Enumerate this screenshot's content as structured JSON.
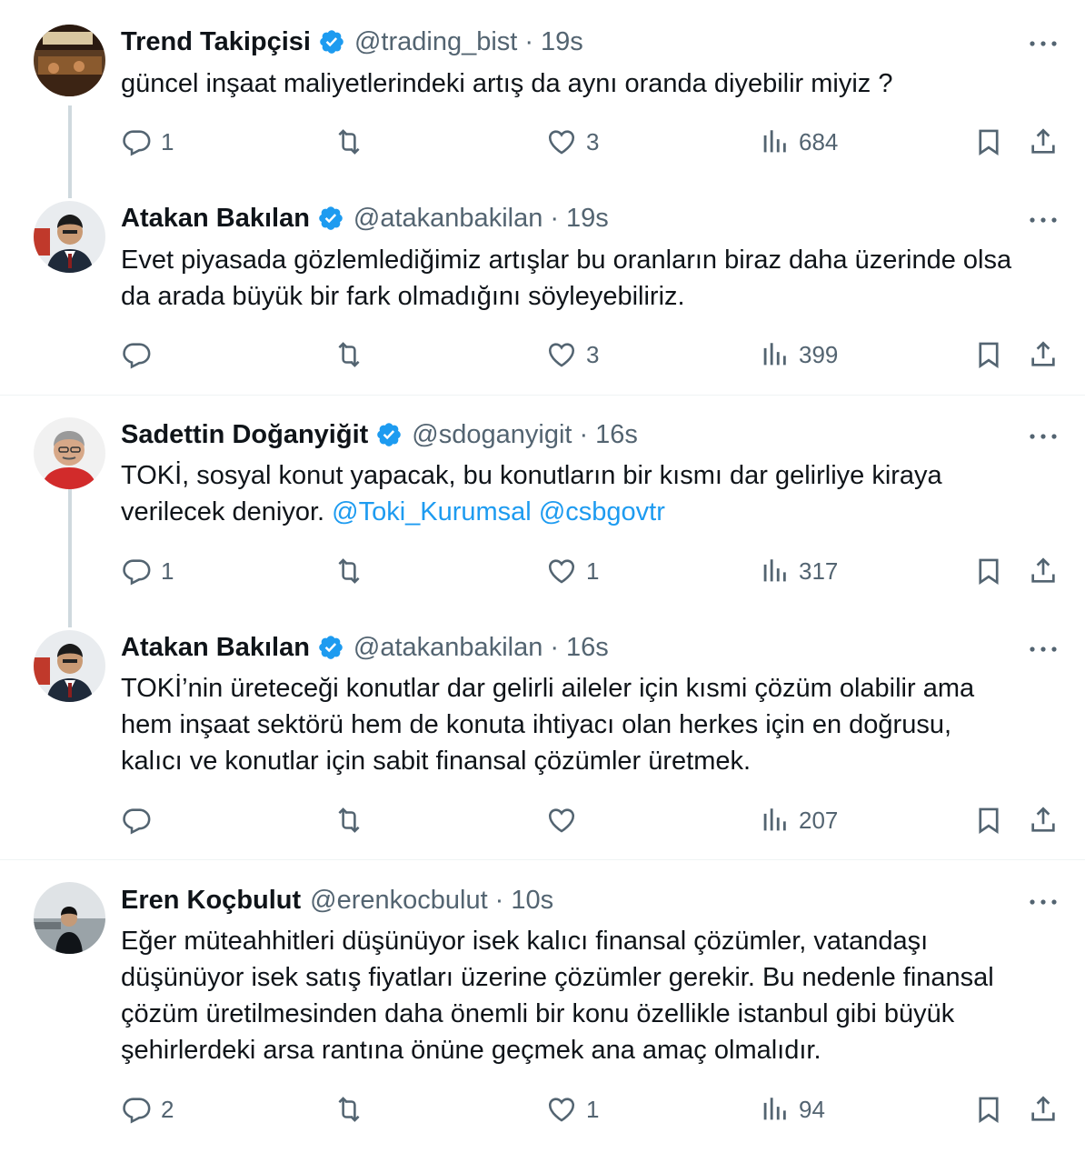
{
  "tweets": [
    {
      "name": "Trend Takipçisi",
      "handle": "@trading_bist",
      "time": "19s",
      "verified": true,
      "text": "güncel inşaat maliyetlerindeki artış da aynı oranda diyebilir miyiz ?",
      "replies": "1",
      "retweets": "",
      "likes": "3",
      "views": "684"
    },
    {
      "name": "Atakan Bakılan",
      "handle": "@atakanbakilan",
      "time": "19s",
      "verified": true,
      "text_lines": [
        "Evet piyasada gözlemlediğimiz artışlar bu oranların biraz daha üzerinde olsa",
        "da arada büyük bir fark olmadığını söyleyebiliriz."
      ],
      "replies": "",
      "retweets": "",
      "likes": "3",
      "views": "399"
    },
    {
      "name": "Sadettin Doğanyiğit",
      "handle": "@sdoganyigit",
      "time": "16s",
      "verified": true,
      "text_line1": "TOKİ, sosyal konut yapacak, bu konutların bir kısmı dar gelirliye kiraya",
      "text_line2": "verilecek deniyor.",
      "mention1": "@Toki_Kurumsal",
      "mention2": "@csbgovtr",
      "replies": "1",
      "retweets": "",
      "likes": "1",
      "views": "317"
    },
    {
      "name": "Atakan Bakılan",
      "handle": "@atakanbakilan",
      "time": "16s",
      "verified": true,
      "text_lines": [
        "TOKİ’nin üreteceği konutlar dar gelirli aileler için kısmi çözüm olabilir ama",
        "hem inşaat sektörü hem de konuta ihtiyacı olan herkes için en doğrusu,",
        "kalıcı ve konutlar için sabit finansal çözümler üretmek."
      ],
      "replies": "",
      "retweets": "",
      "likes": "",
      "views": "207"
    },
    {
      "name": "Eren Koçbulut",
      "handle": "@erenkocbulut",
      "time": "10s",
      "verified": false,
      "text_lines": [
        "Eğer müteahhitleri düşünüyor isek kalıcı finansal çözümler, vatandaşı",
        "düşünüyor isek satış fiyatları üzerine çözümler gerekir. Bu nedenle finansal",
        "çözüm üretilmesinden daha önemli bir konu özellikle istanbul gibi büyük",
        "şehirlerdeki arsa rantına önüne geçmek ana amaç olmalıdır."
      ],
      "replies": "2",
      "retweets": "",
      "likes": "1",
      "views": "94"
    }
  ],
  "separator": "·",
  "colors": {
    "accent": "#1d9bf0",
    "muted": "#536471",
    "text": "#0f1419",
    "line": "#cfd9de"
  },
  "icons": [
    "verified-badge-icon",
    "more-icon",
    "reply-icon",
    "retweet-icon",
    "like-icon",
    "views-icon",
    "bookmark-icon",
    "share-icon"
  ]
}
